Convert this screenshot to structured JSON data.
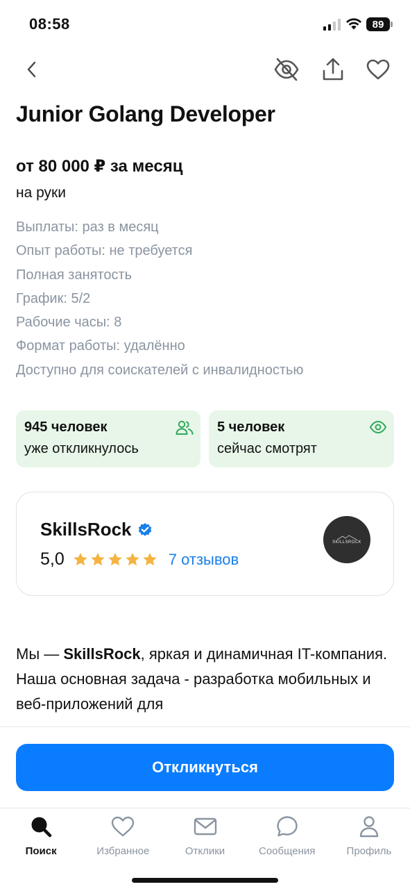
{
  "status_bar": {
    "time": "08:58",
    "battery": "89"
  },
  "vacancy": {
    "title": "Junior Golang Developer",
    "salary": "от 80 000 ₽ за месяц",
    "salary_note": "на руки",
    "details": [
      "Выплаты: раз в месяц",
      "Опыт работы: не требуется",
      "Полная занятость",
      "График: 5/2",
      "Рабочие часы: 8",
      "Формат работы: удалённо",
      "Доступно для соискателей с инвалидностью"
    ]
  },
  "stats": [
    {
      "line1": "945 человек",
      "line2": "уже откликнулось",
      "icon": "people-icon"
    },
    {
      "line1": "5 человек",
      "line2": "сейчас смотрят",
      "icon": "eye-icon"
    }
  ],
  "company": {
    "name": "SkillsRock",
    "rating": "5,0",
    "stars": 5,
    "reviews": "7 отзывов",
    "logo_text": "SKILLSROCK"
  },
  "description": {
    "prefix": "Мы — ",
    "company_bold": "SkillsRock",
    "text": ", яркая и динамичная IT-компания. Наша основная задача - разработка мобильных и веб-приложений для"
  },
  "apply_button": "Откликнуться",
  "tabbar": [
    {
      "label": "Поиск",
      "icon": "search-icon",
      "active": true
    },
    {
      "label": "Избранное",
      "icon": "heart-icon",
      "active": false
    },
    {
      "label": "Отклики",
      "icon": "mail-icon",
      "active": false
    },
    {
      "label": "Сообщения",
      "icon": "chat-icon",
      "active": false
    },
    {
      "label": "Профиль",
      "icon": "profile-icon",
      "active": false
    }
  ],
  "colors": {
    "accent": "#0a7cff",
    "stat_bg": "#e7f6e8",
    "stat_icon": "#2fa85c",
    "star": "#f5b342",
    "link": "#1a7fe8",
    "muted": "#8a94a0"
  }
}
